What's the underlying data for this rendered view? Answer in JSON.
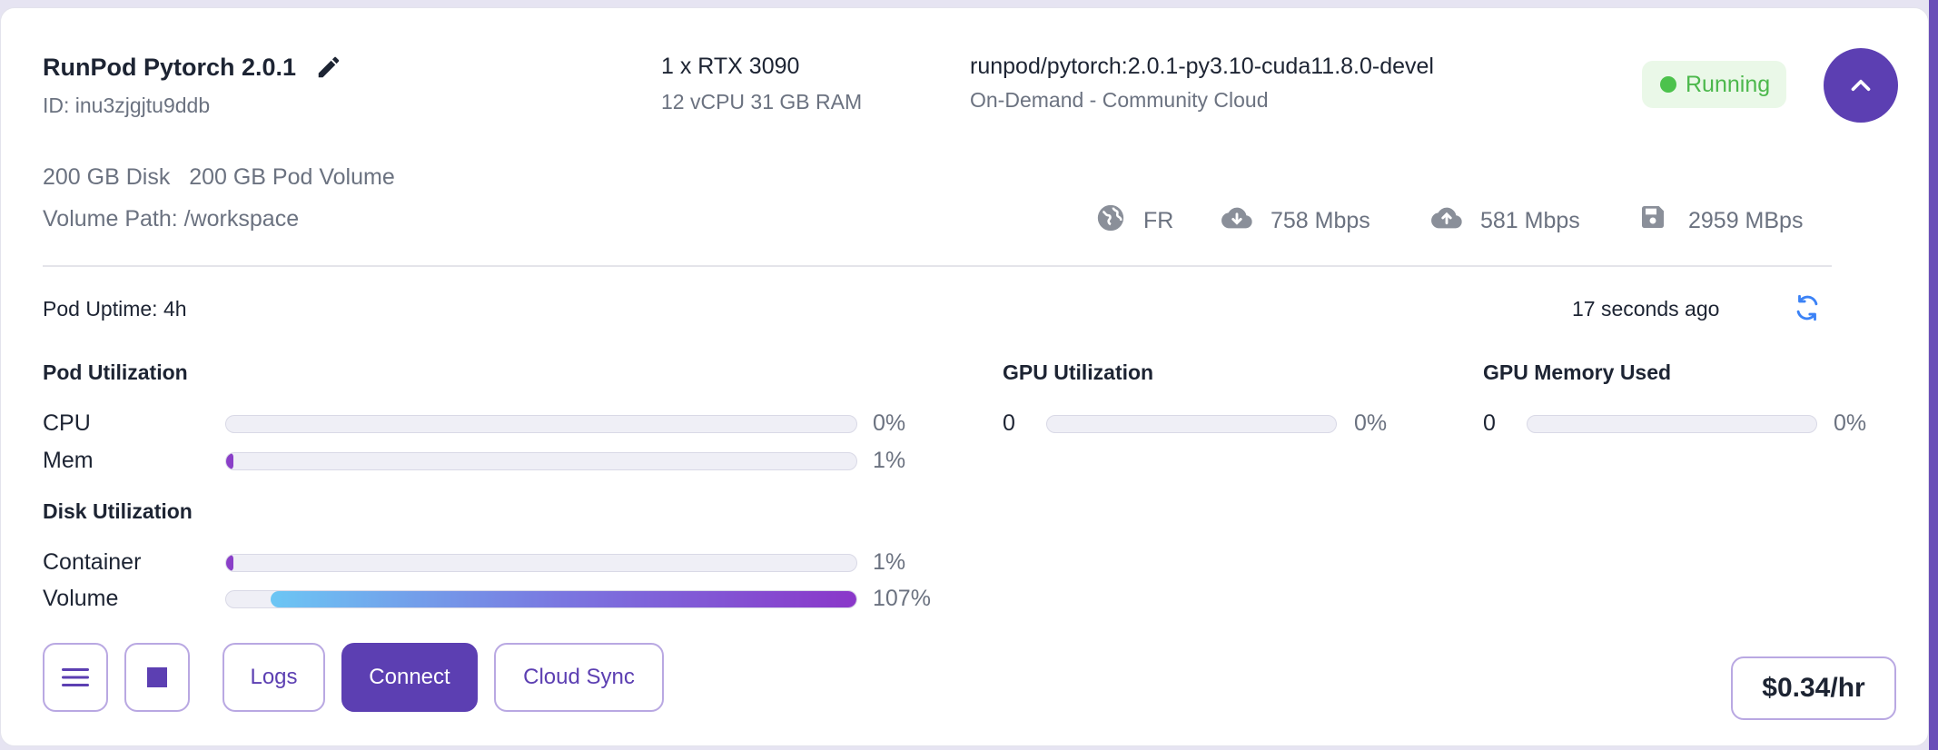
{
  "pod": {
    "name": "RunPod Pytorch 2.0.1",
    "id": "ID: inu3zjgjtu9ddb",
    "gpu": "1 x RTX 3090",
    "spec": "12 vCPU 31 GB RAM",
    "image": "runpod/pytorch:2.0.1-py3.10-cuda11.8.0-devel",
    "cloud": "On-Demand - Community Cloud",
    "status": "Running",
    "disk": "200 GB Disk",
    "pod_volume": "200 GB Pod Volume",
    "volume_path": "Volume Path: /workspace"
  },
  "network": {
    "region": "FR",
    "download": "758 Mbps",
    "upload": "581 Mbps",
    "disk_speed": "2959 MBps",
    "icons": [
      "globe-icon",
      "cloud-download-icon",
      "cloud-upload-icon",
      "floppy-disk-icon"
    ]
  },
  "uptime": {
    "label": "Pod Uptime: 4h",
    "updated": "17 seconds ago"
  },
  "pod_util": {
    "title": "Pod Utilization",
    "cpu": {
      "label": "CPU",
      "pct": "0%",
      "fraction": 0.0
    },
    "mem": {
      "label": "Mem",
      "pct": "1%",
      "fraction": 0.01
    }
  },
  "disk_util": {
    "title": "Disk Utilization",
    "container": {
      "label": "Container",
      "pct": "1%",
      "fraction": 0.01
    },
    "volume": {
      "label": "Volume",
      "pct": "107%",
      "fraction": 1.07
    }
  },
  "gpu_util": {
    "title": "GPU Utilization",
    "index": "0",
    "pct": "0%",
    "fraction": 0.0
  },
  "gpu_mem": {
    "title": "GPU Memory Used",
    "index": "0",
    "pct": "0%",
    "fraction": 0.0
  },
  "actions": {
    "logs": "Logs",
    "connect": "Connect",
    "cloud_sync": "Cloud Sync",
    "price": "$0.34/hr"
  },
  "colors": {
    "accent": "#5c3fb2",
    "running": "#4cc24c",
    "bar_fill": "#8a3fc8"
  }
}
